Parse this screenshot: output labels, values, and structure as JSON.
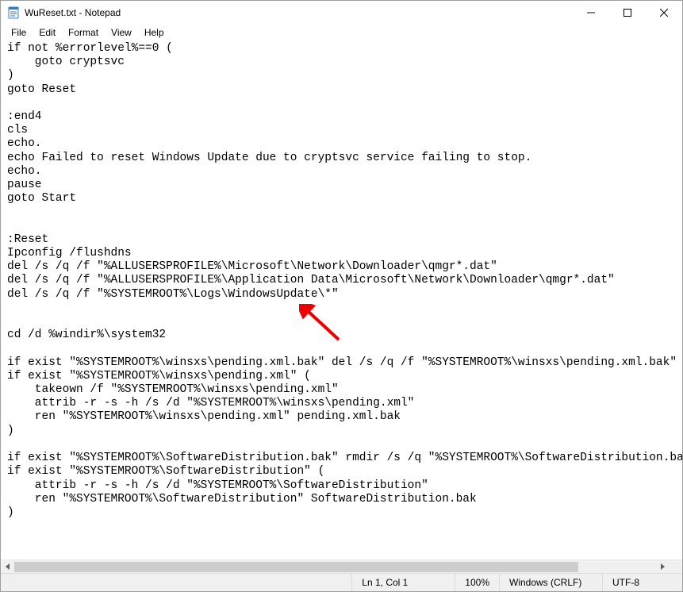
{
  "window": {
    "title": "WuReset.txt - Notepad"
  },
  "menu": {
    "file": "File",
    "edit": "Edit",
    "format": "Format",
    "view": "View",
    "help": "Help"
  },
  "editor": {
    "content": "if not %errorlevel%==0 (\n    goto cryptsvc\n)\ngoto Reset\n\n:end4\ncls\necho.\necho Failed to reset Windows Update due to cryptsvc service failing to stop.\necho.\npause\ngoto Start\n\n\n:Reset\nIpconfig /flushdns\ndel /s /q /f \"%ALLUSERSPROFILE%\\Microsoft\\Network\\Downloader\\qmgr*.dat\"\ndel /s /q /f \"%ALLUSERSPROFILE%\\Application Data\\Microsoft\\Network\\Downloader\\qmgr*.dat\"\ndel /s /q /f \"%SYSTEMROOT%\\Logs\\WindowsUpdate\\*\"\n\n\ncd /d %windir%\\system32\n\nif exist \"%SYSTEMROOT%\\winsxs\\pending.xml.bak\" del /s /q /f \"%SYSTEMROOT%\\winsxs\\pending.xml.bak\"\nif exist \"%SYSTEMROOT%\\winsxs\\pending.xml\" (\n    takeown /f \"%SYSTEMROOT%\\winsxs\\pending.xml\"\n    attrib -r -s -h /s /d \"%SYSTEMROOT%\\winsxs\\pending.xml\"\n    ren \"%SYSTEMROOT%\\winsxs\\pending.xml\" pending.xml.bak\n)\n\nif exist \"%SYSTEMROOT%\\SoftwareDistribution.bak\" rmdir /s /q \"%SYSTEMROOT%\\SoftwareDistribution.bak\"\nif exist \"%SYSTEMROOT%\\SoftwareDistribution\" (\n    attrib -r -s -h /s /d \"%SYSTEMROOT%\\SoftwareDistribution\"\n    ren \"%SYSTEMROOT%\\SoftwareDistribution\" SoftwareDistribution.bak\n)\n"
  },
  "status": {
    "lncol": "Ln 1, Col 1",
    "zoom": "100%",
    "eol": "Windows (CRLF)",
    "encoding": "UTF-8"
  }
}
